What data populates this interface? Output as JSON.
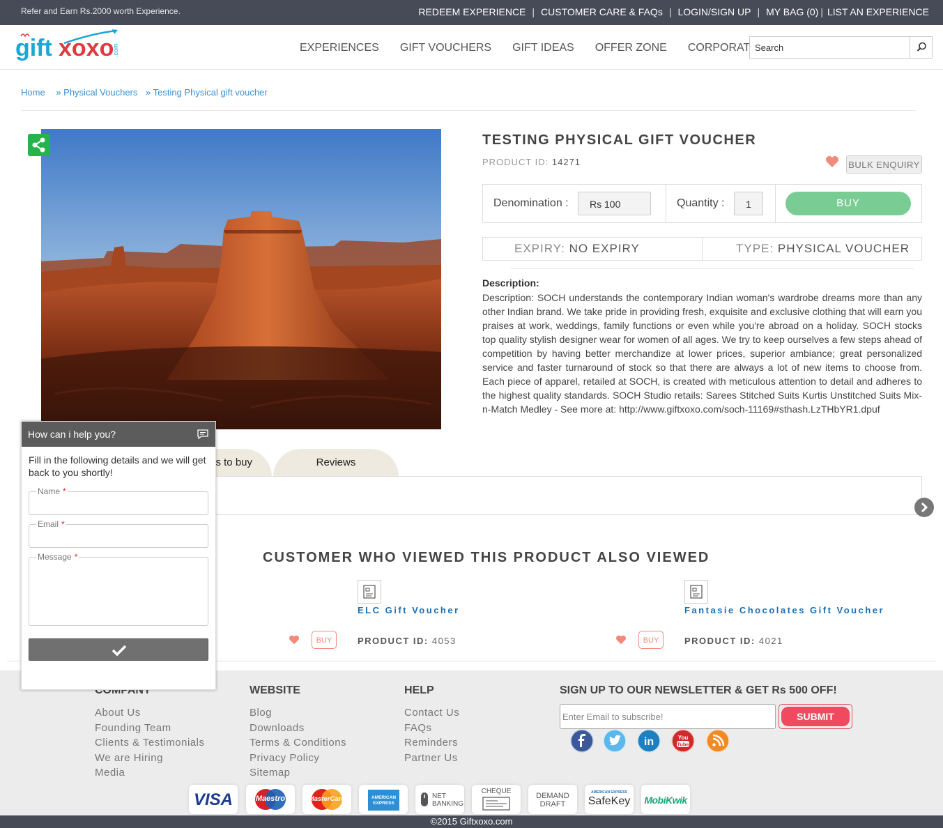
{
  "topbar": {
    "refer": "Refer and Earn Rs.2000 worth Experience.",
    "links": [
      "REDEEM EXPERIENCE",
      "CUSTOMER CARE & FAQs",
      "LOGIN/SIGN UP",
      "MY BAG (0)",
      "LIST AN EXPERIENCE"
    ]
  },
  "header": {
    "logo_text": "giftxoxo",
    "logo_suffix": ".com",
    "nav": [
      "EXPERIENCES",
      "GIFT VOUCHERS",
      "GIFT IDEAS",
      "OFFER ZONE",
      "CORPORATE"
    ],
    "search_placeholder": "Search"
  },
  "breadcrumb": [
    "Home",
    "» Physical Vouchers",
    "» Testing Physical gift voucher"
  ],
  "product": {
    "title": "TESTING PHYSICAL GIFT VOUCHER",
    "id_label": "PRODUCT ID:",
    "id": "14271",
    "bulk_label": "BULK ENQUIRY",
    "denomination_label": "Denomination :",
    "denomination_value": "Rs 100",
    "quantity_label": "Quantity :",
    "quantity_value": "1",
    "buy_label": "BUY",
    "expiry_label": "EXPIRY:",
    "expiry_value": "NO EXPIRY",
    "type_label": "TYPE:",
    "type_value": "PHYSICAL VOUCHER",
    "description_heading": "Description:",
    "description": "Description: SOCH understands the contemporary Indian woman's wardrobe dreams more than any other Indian brand. We take pride in providing fresh, exquisite and exclusive clothing that will earn you praises at work, weddings, family functions or even while you're abroad on a holiday. SOCH stocks top quality stylish designer wear for women of all ages. We try to keep ourselves a few steps ahead of competition by having better merchandize at lower prices, superior ambiance; great personalized service and faster turnaround of stock so that there are always a lot of new items to choose from. Each piece of apparel, retailed at SOCH, is created with meticulous attention to detail and adheres to the highest quality standards. SOCH Studio retails: Sarees Stitched Suits Kurtis Unstitched Suits Mix-n-Match Medley - See more at: http://www.giftxoxo.com/soch-11169#sthash.LzTHbYR1.dpuf"
  },
  "tabs": [
    "s to buy",
    "Reviews"
  ],
  "also_viewed": {
    "heading": "CUSTOMER WHO VIEWED THIS PRODUCT ALSO VIEWED",
    "items": [
      {
        "name": "ELC Gift Voucher",
        "id_label": "PRODUCT ID:",
        "id": "4053",
        "buy": "BUY"
      },
      {
        "name": "Fantasie Chocolates Gift Voucher",
        "id_label": "PRODUCT ID:",
        "id": "4021",
        "buy": "BUY"
      }
    ]
  },
  "chat": {
    "title": "How can i help you?",
    "intro": "Fill in the following details and we will get back to you shortly!",
    "name_label": "Name",
    "email_label": "Email",
    "message_label": "Message",
    "required": "*"
  },
  "footer": {
    "company": {
      "heading": "COMPANY",
      "links": [
        "About Us",
        "Founding Team",
        "Clients & Testimonials",
        "We are Hiring",
        "Media"
      ]
    },
    "website": {
      "heading": "WEBSITE",
      "links": [
        "Blog",
        "Downloads",
        "Terms & Conditions",
        "Privacy Policy",
        "Sitemap"
      ]
    },
    "help": {
      "heading": "HELP",
      "links": [
        "Contact Us",
        "FAQs",
        "Reminders",
        "Partner Us"
      ]
    },
    "newsletter_heading": "SIGN UP TO OUR NEWSLETTER & GET Rs 500 OFF!",
    "newsletter_placeholder": "Enter Email to subscribe!",
    "submit_label": "SUBMIT",
    "social": [
      "facebook-icon",
      "twitter-icon",
      "linkedin-icon",
      "youtube-icon",
      "rss-icon"
    ],
    "payments": {
      "visa": "VISA",
      "maestro": "Maestro",
      "mastercard": "MasterCard",
      "amex": "AMERICAN EXPRESS",
      "netbanking_1": "NET",
      "netbanking_2": "BANKING",
      "cheque": "CHEQUE",
      "demand_1": "DEMAND",
      "demand_2": "DRAFT",
      "safekey_top": "AMERICAN EXPRESS",
      "safekey": "SafeKey",
      "mobikwik": "MobiKwik"
    },
    "copyright": "©2015 Giftxoxo.com"
  },
  "colors": {
    "topbar": "#474b57",
    "accent_blue": "#1a6fb0",
    "buy_green": "#7acc95",
    "heart": "#f08a7b",
    "submit_red": "#ee4a60"
  }
}
